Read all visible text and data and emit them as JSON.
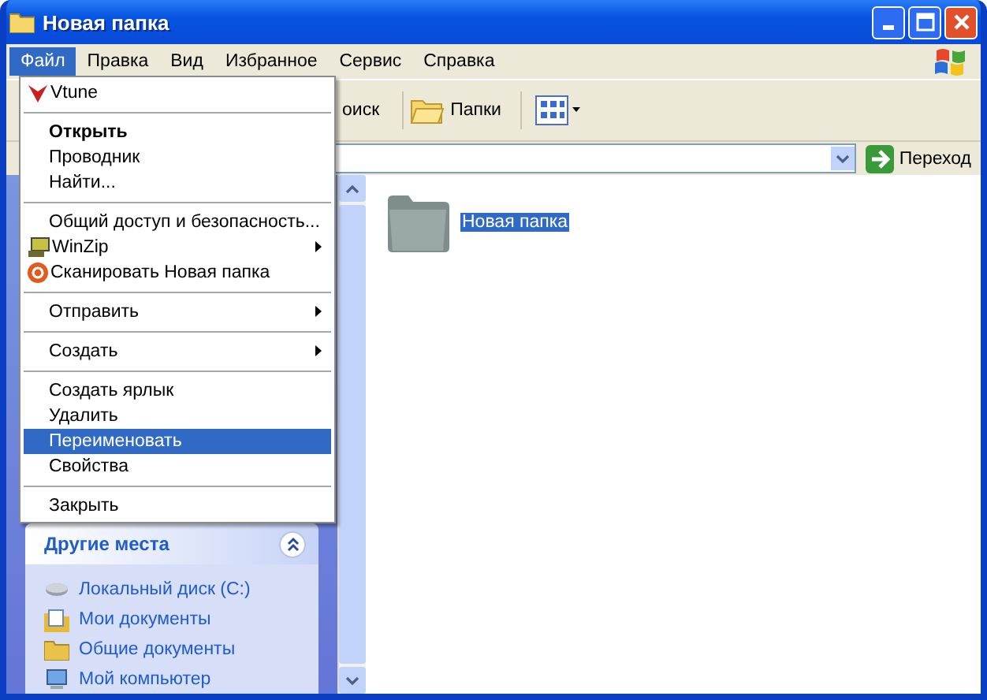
{
  "window": {
    "title": "Новая папка"
  },
  "menu_bar": [
    {
      "label": "Файл",
      "selected": true
    },
    {
      "label": "Правка",
      "selected": false
    },
    {
      "label": "Вид",
      "selected": false
    },
    {
      "label": "Избранное",
      "selected": false
    },
    {
      "label": "Сервис",
      "selected": false
    },
    {
      "label": "Справка",
      "selected": false
    }
  ],
  "toolbar": [
    {
      "label": "оиск",
      "kind": "text"
    },
    {
      "label": "Папки",
      "kind": "folders"
    },
    {
      "kind": "views"
    }
  ],
  "address_bar": {
    "go_button": "Переход"
  },
  "file_menu": [
    {
      "kind": "item",
      "label": "Vtune",
      "default": false,
      "submenu": false,
      "selected": false
    },
    {
      "kind": "separator"
    },
    {
      "kind": "item",
      "label": "Открыть",
      "default": true,
      "submenu": false,
      "selected": false
    },
    {
      "kind": "item",
      "label": "Проводник",
      "default": false,
      "submenu": false,
      "selected": false
    },
    {
      "kind": "item",
      "label": "Найти...",
      "default": false,
      "submenu": false,
      "selected": false
    },
    {
      "kind": "separator"
    },
    {
      "kind": "item",
      "label": "Общий доступ и безопасность...",
      "default": false,
      "submenu": false,
      "selected": false
    },
    {
      "kind": "item",
      "label": "WinZip",
      "default": false,
      "submenu": true,
      "selected": false
    },
    {
      "kind": "item",
      "label": "Сканировать Новая папка",
      "default": false,
      "submenu": false,
      "selected": false
    },
    {
      "kind": "separator"
    },
    {
      "kind": "item",
      "label": "Отправить",
      "default": false,
      "submenu": true,
      "selected": false
    },
    {
      "kind": "separator"
    },
    {
      "kind": "item",
      "label": "Создать",
      "default": false,
      "submenu": true,
      "selected": false
    },
    {
      "kind": "separator"
    },
    {
      "kind": "item",
      "label": "Создать ярлык",
      "default": false,
      "submenu": false,
      "selected": false
    },
    {
      "kind": "item",
      "label": "Удалить",
      "default": false,
      "submenu": false,
      "selected": false
    },
    {
      "kind": "item",
      "label": "Переименовать",
      "default": false,
      "submenu": false,
      "selected": true
    },
    {
      "kind": "item",
      "label": "Свойства",
      "default": false,
      "submenu": false,
      "selected": false
    },
    {
      "kind": "separator"
    },
    {
      "kind": "item",
      "label": "Закрыть",
      "default": false,
      "submenu": false,
      "selected": false
    }
  ],
  "other_places": {
    "title": "Другие места",
    "items": [
      {
        "label": "Локальный диск (C:)"
      },
      {
        "label": "Мои документы"
      },
      {
        "label": "Общие документы"
      },
      {
        "label": "Мой компьютер"
      }
    ]
  },
  "files": [
    {
      "name": "Новая папка",
      "selected": true
    }
  ]
}
